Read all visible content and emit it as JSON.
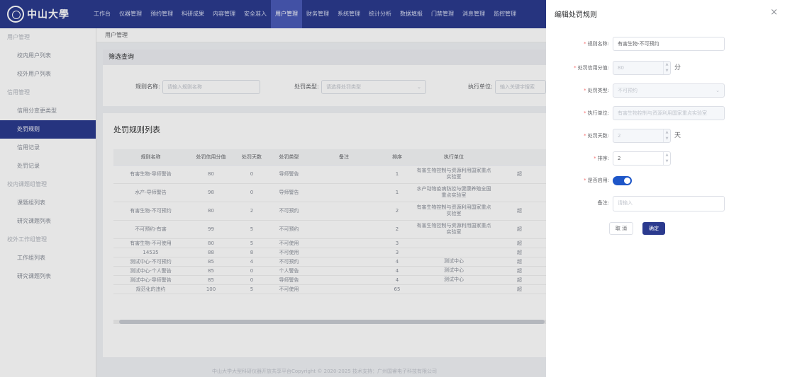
{
  "brand": {
    "logo_text": "中山大學"
  },
  "nav": [
    "工作台",
    "仪器管理",
    "预约管理",
    "科研成果",
    "内容管理",
    "安全准入",
    "用户管理",
    "财务管理",
    "系统管理",
    "统计分析",
    "数据填报",
    "门禁管理",
    "消息管理",
    "监控管理"
  ],
  "nav_active": "用户管理",
  "sidebar": [
    {
      "label": "用户管理",
      "type": "group"
    },
    {
      "label": "校内用户列表",
      "type": "item"
    },
    {
      "label": "校外用户列表",
      "type": "item"
    },
    {
      "label": "信用管理",
      "type": "group"
    },
    {
      "label": "信用分变更类型",
      "type": "item"
    },
    {
      "label": "处罚规则",
      "type": "item",
      "selected": true
    },
    {
      "label": "信用记录",
      "type": "item"
    },
    {
      "label": "处罚记录",
      "type": "item"
    },
    {
      "label": "校内课题组管理",
      "type": "group"
    },
    {
      "label": "课题组列表",
      "type": "item"
    },
    {
      "label": "研究课题列表",
      "type": "item"
    },
    {
      "label": "校外工作组管理",
      "type": "group"
    },
    {
      "label": "工作组列表",
      "type": "item"
    },
    {
      "label": "研究课题列表",
      "type": "item"
    }
  ],
  "breadcrumb": "用户管理",
  "filter": {
    "title": "筛选查询",
    "rule_name_label": "规则名称:",
    "rule_name_placeholder": "请输入规则名称",
    "type_label": "处罚类型:",
    "type_placeholder": "请选择处罚类型",
    "unit_label": "执行单位:",
    "unit_placeholder": "输入关键字搜索"
  },
  "list": {
    "title": "处罚规则列表",
    "columns": [
      "规则名称",
      "处罚信用分值",
      "处罚天数",
      "处罚类型",
      "备注",
      "排序",
      "执行单位"
    ],
    "rows": [
      {
        "name": "有害生物-导师警告",
        "score": "80",
        "days": "0",
        "type": "导师警告",
        "note": "",
        "sort": "1",
        "unit": "有害生物控制与资源利用国家重点实验室",
        "extra": "超"
      },
      {
        "name": "水产-导师警告",
        "score": "98",
        "days": "0",
        "type": "导师警告",
        "note": "",
        "sort": "1",
        "unit": "水产动物疫病防控与健康养殖全国重点实验室",
        "extra": ""
      },
      {
        "name": "有害生物-不可预约",
        "score": "80",
        "days": "2",
        "type": "不可预约",
        "note": "",
        "sort": "2",
        "unit": "有害生物控制与资源利用国家重点实验室",
        "extra": "超"
      },
      {
        "name": "不可预约-有害",
        "score": "99",
        "days": "5",
        "type": "不可预约",
        "note": "",
        "sort": "2",
        "unit": "有害生物控制与资源利用国家重点实验室",
        "extra": "超"
      },
      {
        "name": "有害生物-不可使用",
        "score": "80",
        "days": "5",
        "type": "不可使用",
        "note": "",
        "sort": "3",
        "unit": "",
        "extra": "超"
      },
      {
        "name": "14535",
        "score": "88",
        "days": "8",
        "type": "不可使用",
        "note": "",
        "sort": "3",
        "unit": "",
        "extra": "超"
      },
      {
        "name": "测试中心-不可预约",
        "score": "85",
        "days": "4",
        "type": "不可预约",
        "note": "",
        "sort": "4",
        "unit": "测试中心",
        "extra": "超"
      },
      {
        "name": "测试中心-个人警告",
        "score": "85",
        "days": "0",
        "type": "个人警告",
        "note": "",
        "sort": "4",
        "unit": "测试中心",
        "extra": "超"
      },
      {
        "name": "测试中心-导师警告",
        "score": "85",
        "days": "0",
        "type": "导师警告",
        "note": "",
        "sort": "4",
        "unit": "测试中心",
        "extra": "超"
      },
      {
        "name": "规范化的违约",
        "score": "100",
        "days": "5",
        "type": "不可使用",
        "note": "",
        "sort": "65",
        "unit": "",
        "extra": "超"
      }
    ]
  },
  "footer": "中山大学大型科研仪器开放共享平台Copyright © 2020-2025 技术支持：广州国睿电子科技有限公司",
  "drawer": {
    "title": "编辑处罚规则",
    "close_icon": "×",
    "fields": {
      "rule_name": {
        "label": "规则名称:",
        "value": "有害生物-不可预约"
      },
      "score": {
        "label": "处罚信用分值:",
        "value": "80",
        "unit": "分"
      },
      "type": {
        "label": "处罚类型:",
        "value": "不可预约"
      },
      "unit": {
        "label": "执行单位:",
        "value": "有害生物控制与资源利用国家重点实验室"
      },
      "days": {
        "label": "处罚天数:",
        "value": "2",
        "unit": "天"
      },
      "sort": {
        "label": "排序:",
        "value": "2"
      },
      "enabled": {
        "label": "是否启用:",
        "value": true
      },
      "note": {
        "label": "备注:",
        "placeholder": "请输入"
      }
    },
    "cancel_label": "取 消",
    "confirm_label": "确定"
  }
}
